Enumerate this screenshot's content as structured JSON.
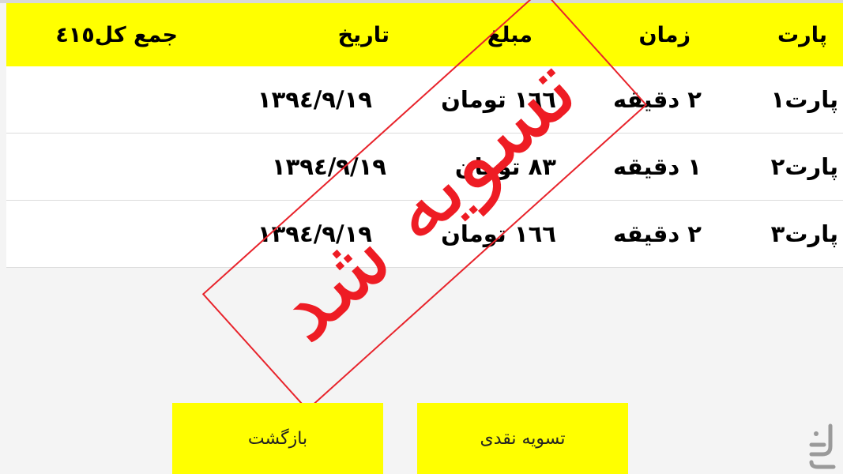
{
  "table": {
    "header": {
      "part": "پارت",
      "time": "زمان",
      "amount": "مبلغ",
      "date": "تاریخ",
      "total": "جمع کل٤١٥"
    },
    "rows": [
      {
        "part": "پارت١",
        "time": "٢ دقیقه",
        "amount": "١٦٦ تومان",
        "date": "١٣٩٤/٩/١٩"
      },
      {
        "part": "پارت٢",
        "time": "١ دقیقه",
        "amount": "٨٣ تومان",
        "date": "١٣٩٤/٩/١٩"
      },
      {
        "part": "پارت٣",
        "time": "٢ دقیقه",
        "amount": "١٦٦ تومان",
        "date": "١٣٩٤/٩/١٩"
      }
    ]
  },
  "stamp": {
    "text": "تسویه شد"
  },
  "buttons": {
    "back": "بازگشت",
    "settle_cash": "تسویه نقدی"
  },
  "colors": {
    "accent": "#ffff00",
    "stamp": "#ee1c24",
    "background": "#f4f4f4"
  }
}
